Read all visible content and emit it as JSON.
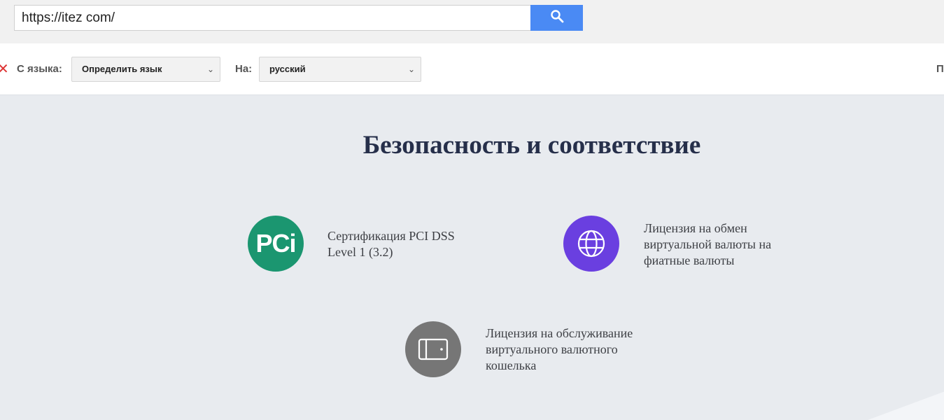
{
  "address_bar": {
    "url": "https://itez com/"
  },
  "translate_bar": {
    "from_label": "С языка:",
    "from_value": "Определить язык",
    "to_label": "На:",
    "to_value": "русский",
    "right_edge_text": "П"
  },
  "main": {
    "heading": "Безопасность и соответствие",
    "features": [
      {
        "icon": "pci-logo-icon",
        "icon_text": "PCi",
        "color": "#1b9670",
        "lines": [
          "Сертификация PCI DSS",
          "Level 1 (3.2)"
        ]
      },
      {
        "icon": "globe-icon",
        "color": "#6a3fe0",
        "lines": [
          "Лицензия на обмен",
          "виртуальной валюты на",
          "фиатные валюты"
        ]
      },
      {
        "icon": "wallet-icon",
        "color": "#767676",
        "lines": [
          "Лицензия на обслуживание",
          "виртуального валютного",
          "кошелька"
        ]
      }
    ]
  },
  "colors": {
    "accent": "#4a8af4",
    "heading": "#262f4a",
    "background": "#e8ebef"
  }
}
